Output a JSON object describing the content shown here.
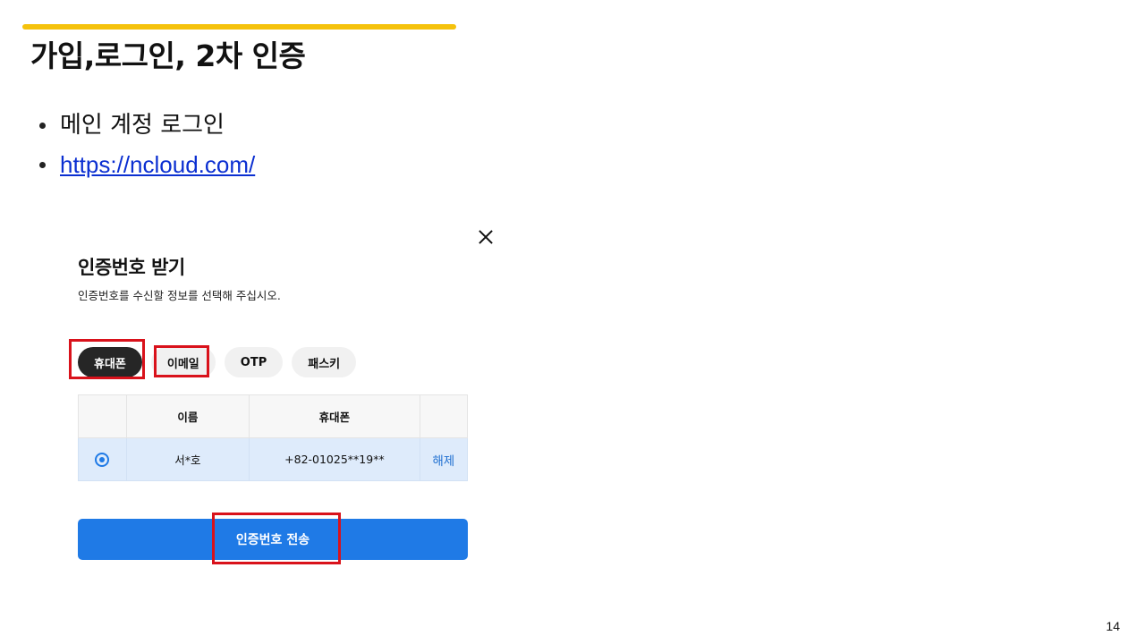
{
  "slide": {
    "title": "가입,로그인, 2차 인증",
    "bullets": [
      "메인 계정 로그인"
    ],
    "link": "https://ncloud.com/",
    "page_number": "14",
    "accent_color": "#f5c20c"
  },
  "dialog": {
    "title": "인증번호 받기",
    "subtitle": "인증번호를 수신할 정보를 선택해 주십시오.",
    "close_icon": "close-icon",
    "tabs": [
      {
        "label": "휴대폰",
        "active": true
      },
      {
        "label": "이메일",
        "active": false
      },
      {
        "label": "OTP",
        "active": false
      },
      {
        "label": "패스키",
        "active": false
      }
    ],
    "table": {
      "headers": [
        "",
        "이름",
        "휴대폰",
        ""
      ],
      "rows": [
        {
          "selected": true,
          "name": "서*호",
          "phone": "+82-01025**19**",
          "action": "해제"
        }
      ]
    },
    "send_button": "인증번호 전송",
    "primary_color": "#1f7ae6"
  },
  "highlight_color": "#d9121b"
}
